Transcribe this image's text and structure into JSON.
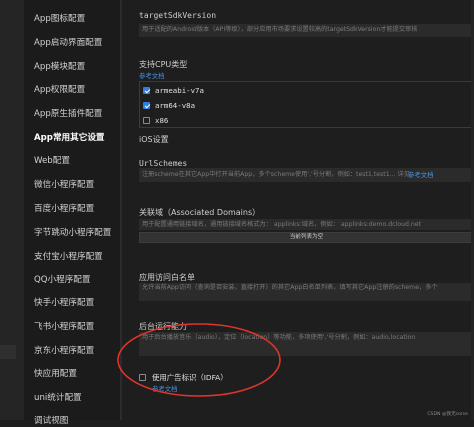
{
  "sidebar": {
    "items": [
      {
        "label": "App图标配置",
        "active": false
      },
      {
        "label": "App启动界面配置",
        "active": false
      },
      {
        "label": "App模块配置",
        "active": false
      },
      {
        "label": "App权限配置",
        "active": false
      },
      {
        "label": "App原生插件配置",
        "active": false
      },
      {
        "label": "App常用其它设置",
        "active": true
      },
      {
        "label": "Web配置",
        "active": false
      },
      {
        "label": "微信小程序配置",
        "active": false
      },
      {
        "label": "百度小程序配置",
        "active": false
      },
      {
        "label": "字节跳动小程序配置",
        "active": false
      },
      {
        "label": "支付宝小程序配置",
        "active": false
      },
      {
        "label": "QQ小程序配置",
        "active": false
      },
      {
        "label": "快手小程序配置",
        "active": false
      },
      {
        "label": "飞书小程序配置",
        "active": false
      },
      {
        "label": "京东小程序配置",
        "active": false
      },
      {
        "label": "快应用配置",
        "active": false
      },
      {
        "label": "uni统计配置",
        "active": false
      },
      {
        "label": "调试视图",
        "active": false
      }
    ]
  },
  "main": {
    "target_sdk": {
      "label": "targetSdkVersion",
      "hint": "用于适配的Android版本（API等级），部分应用市场要求设置较高的targetSdkVersion才能提交审核"
    },
    "cpu": {
      "label": "支持CPU类型",
      "link": "参考文档",
      "options": [
        {
          "label": "armeabi-v7a",
          "checked": true
        },
        {
          "label": "arm64-v8a",
          "checked": true
        },
        {
          "label": "x86",
          "checked": false
        }
      ]
    },
    "ios_header": "iOS设置",
    "url_schemes": {
      "label": "UrlSchemes",
      "hint": "注册scheme在其它App中打开当前App，多个scheme使用','号分割，例如：test1,test1... 详见",
      "link": "参考文档"
    },
    "associated_domains": {
      "label": "关联域（Associated Domains）",
      "hint": "用于配置通用链接域名，通用链接域名格式为： applinks:域名，例如： applinks:demo.dcloud.net",
      "button": "当前列表为空"
    },
    "url_whitelist": {
      "label": "应用访问白名单",
      "hint": "允许当前App访问（查询是否安装，直接打开）的其它App白名单列表，填写其它App注册的scheme，多个"
    },
    "background_modes": {
      "label": "后台运行能力",
      "hint": "用于后台播放音乐（audio），定位（location）等功能，多项使用','号分割，例如：audio,location"
    },
    "idfa": {
      "label": "使用广告标识（IDFA）",
      "link": "参考文档",
      "checked": false
    }
  },
  "watermark": "CSDN @我无sorse",
  "colors": {
    "accent": "#2f7ee0",
    "link": "#4a90e2",
    "annotation": "#e0342c"
  }
}
